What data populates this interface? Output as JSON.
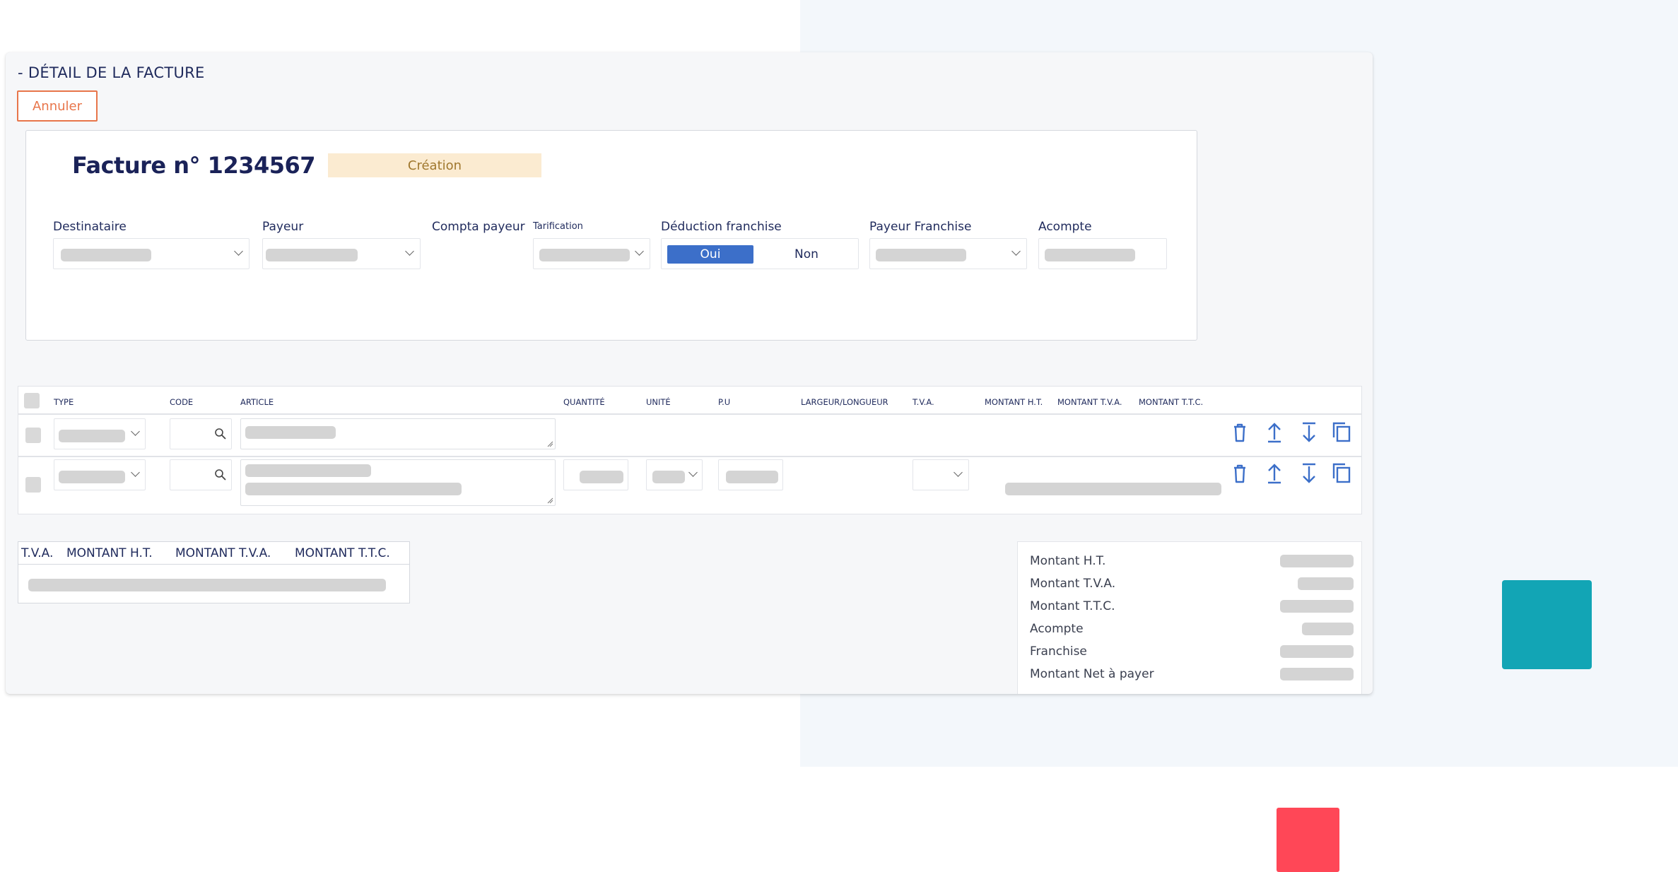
{
  "section": {
    "title": "- DÉTAIL DE LA FACTURE",
    "cancel_label": "Annuler"
  },
  "invoice": {
    "title": "Facture n° 1234567",
    "status": "Création"
  },
  "fields": {
    "destinataire": "Destinataire",
    "payeur": "Payeur",
    "compta_payeur": "Compta payeur",
    "tarification": "Tarification",
    "deduction_franchise": "Déduction franchise",
    "payeur_franchise": "Payeur Franchise",
    "acompte": "Acompte"
  },
  "deduction_toggle": {
    "yes": "Oui",
    "no": "Non",
    "selected": "Oui"
  },
  "lines_table": {
    "columns": {
      "type": "TYPE",
      "code": "CODE",
      "article": "ARTICLE",
      "quantite": "QUANTITÉ",
      "unite": "UNITÉ",
      "pu": "P.U",
      "largeur": "LARGEUR/LONGUEUR",
      "tva": "T.V.A.",
      "montant_ht": "MONTANT H.T.",
      "montant_tva": "MONTANT T.V.A.",
      "montant_ttc": "MONTANT T.T.C."
    },
    "row_actions": [
      "trash-icon",
      "arrow-up-icon",
      "arrow-down-icon",
      "copy-icon"
    ]
  },
  "tva_summary": {
    "columns": {
      "tva": "T.V.A.",
      "ht": "MONTANT H.T.",
      "tva_amount": "MONTANT T.V.A.",
      "ttc": "MONTANT T.T.C."
    }
  },
  "totals": {
    "ht": "Montant H.T.",
    "tva": "Montant T.V.A.",
    "ttc": "Montant T.T.C.",
    "acompte": "Acompte",
    "franchise": "Franchise",
    "net": "Montant Net à payer"
  },
  "colors": {
    "accent": "#3c6fc9",
    "cancel": "#e8754a",
    "status_bg": "#fbebd1",
    "teal": "#12a5b5",
    "red": "#ff4757"
  }
}
